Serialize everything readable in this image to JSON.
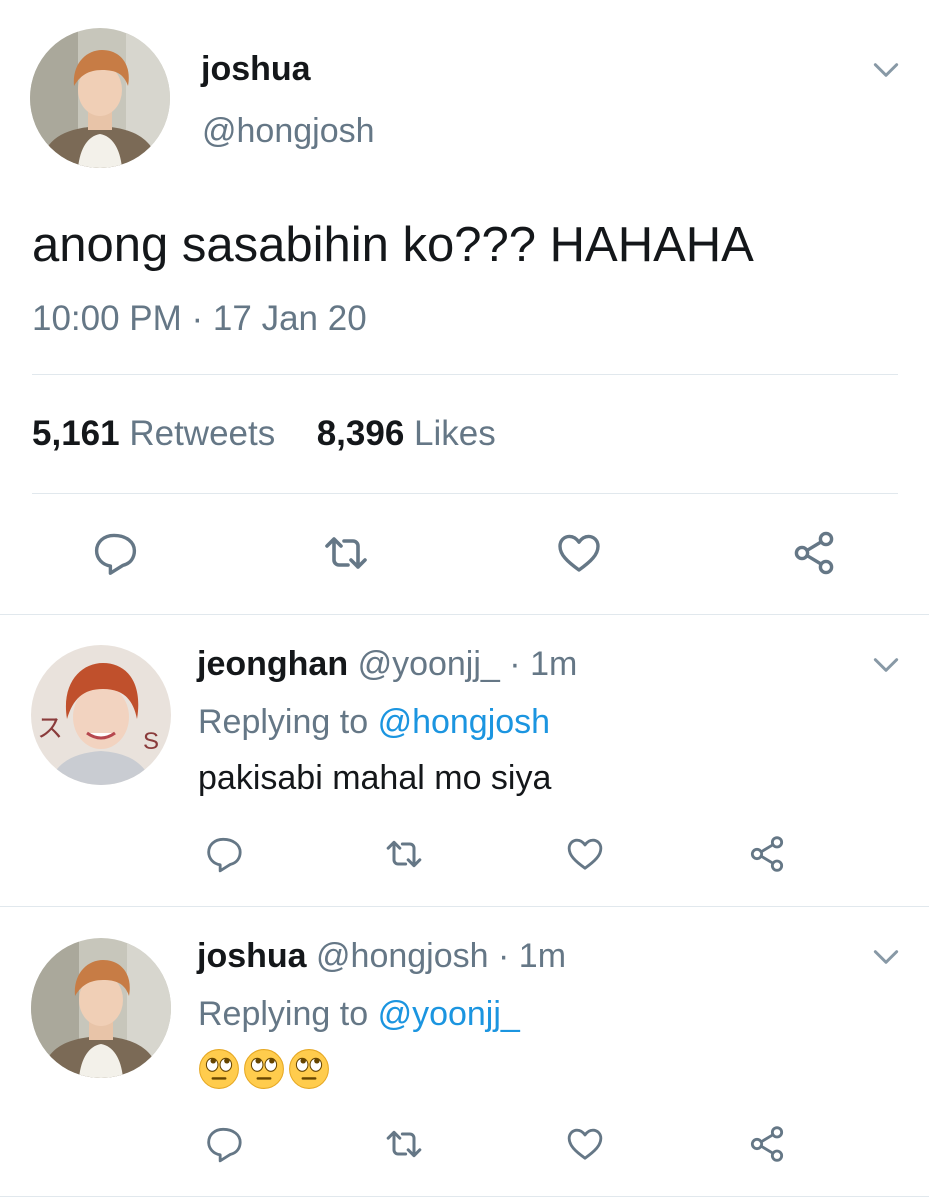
{
  "main_tweet": {
    "display_name": "joshua",
    "handle": "@hongjosh",
    "text": "anong sasabihin ko??? HAHAHA",
    "timestamp": "10:00 PM · 17 Jan 20",
    "retweets_count": "5,161",
    "retweets_label": "Retweets",
    "likes_count": "8,396",
    "likes_label": "Likes"
  },
  "replies": [
    {
      "display_name": "jeonghan",
      "handle": "@yoonjj_",
      "separator": "·",
      "time": "1m",
      "replying_prefix": "Replying to",
      "replying_to": "@hongjosh",
      "text": "pakisabi mahal mo siya"
    },
    {
      "display_name": "joshua",
      "handle": "@hongjosh",
      "separator": "·",
      "time": "1m",
      "replying_prefix": "Replying to",
      "replying_to": "@yoonjj_",
      "emojis": [
        "face-with-rolling-eyes",
        "face-with-rolling-eyes",
        "face-with-rolling-eyes"
      ]
    }
  ],
  "colors": {
    "text_primary": "#14171a",
    "text_secondary": "#657786",
    "link": "#1b95e0",
    "icon": "#657786",
    "divider": "#e1e8ed"
  },
  "icons": [
    "chevron-down-icon",
    "reply-icon",
    "retweet-icon",
    "like-icon",
    "share-icon"
  ]
}
